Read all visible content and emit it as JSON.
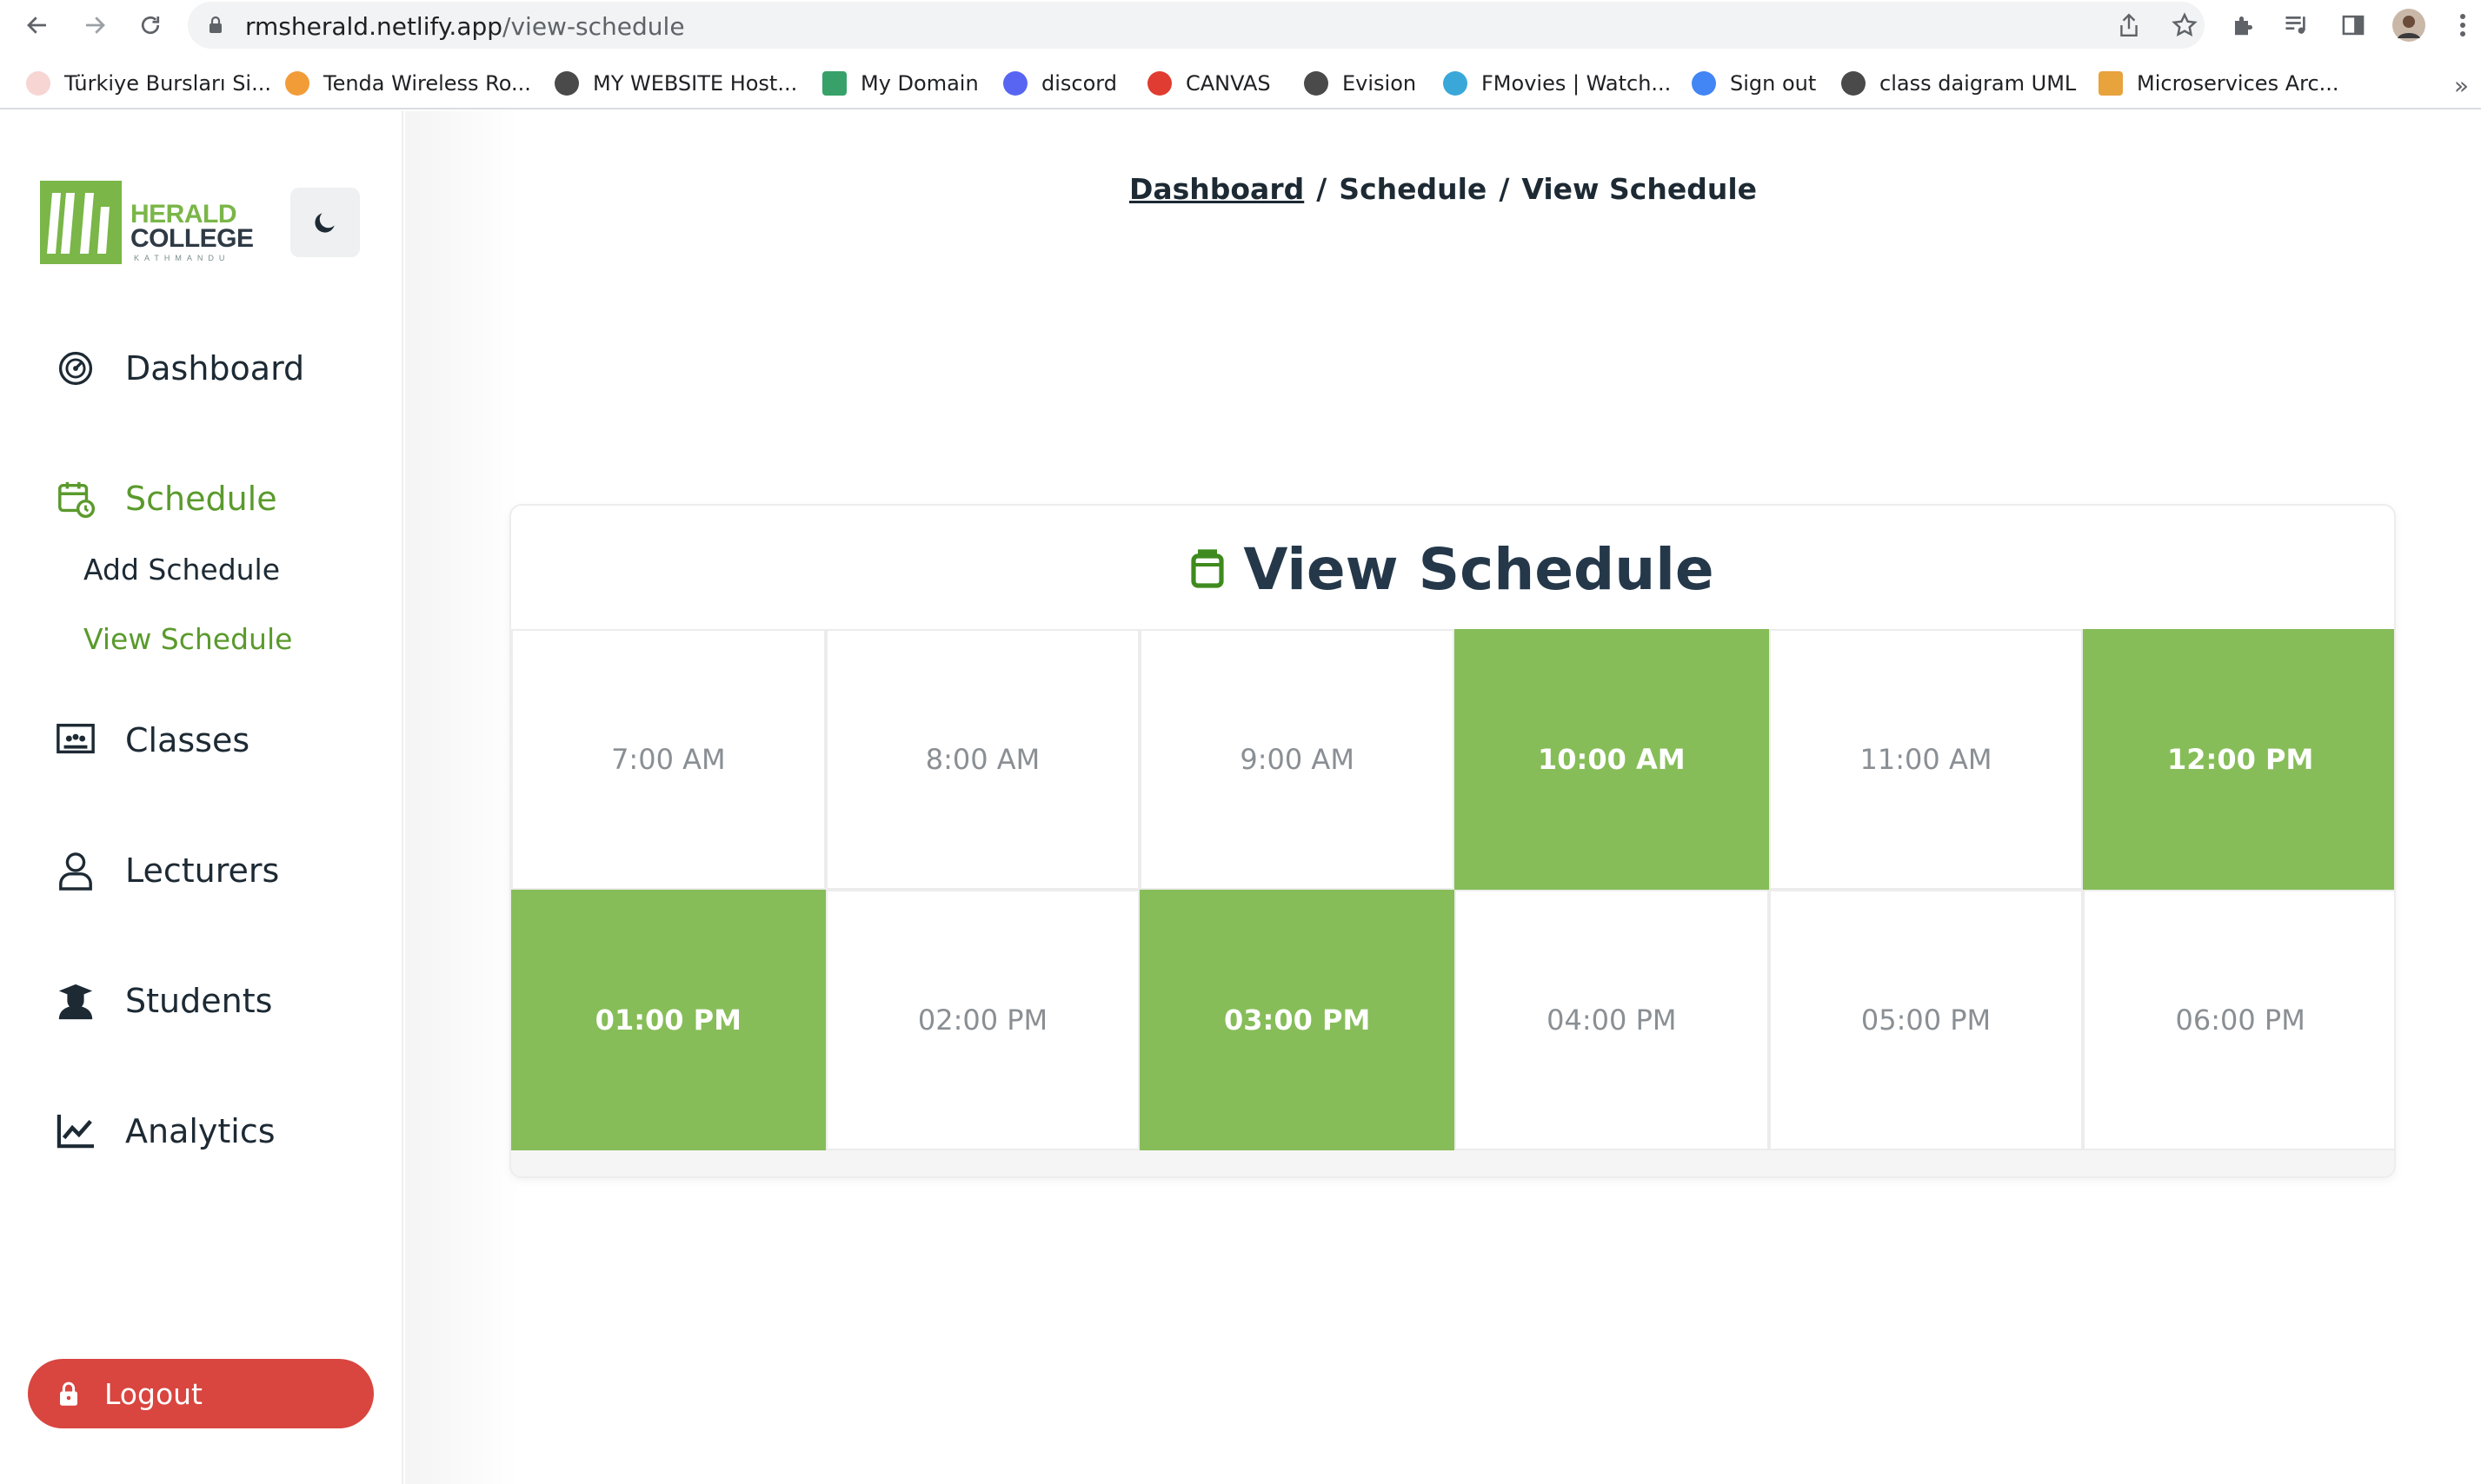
{
  "browser": {
    "url_host": "rmsherald.netlify.app",
    "url_path": "/view-schedule",
    "bookmarks": [
      {
        "label": "Türkiye Bursları Si...",
        "color": "#d93025"
      },
      {
        "label": "Tenda Wireless Ro...",
        "color": "#f29c38"
      },
      {
        "label": "MY WEBSITE Host...",
        "color": "#4a4a4a"
      },
      {
        "label": "My Domain",
        "color": "#38a169"
      },
      {
        "label": "discord",
        "color": "#5865f2"
      },
      {
        "label": "CANVAS",
        "color": "#e03c31"
      },
      {
        "label": "Evision",
        "color": "#4a4a4a"
      },
      {
        "label": "FMovies | Watch...",
        "color": "#3aa7d9"
      },
      {
        "label": "Sign out",
        "color": "#4285f4"
      },
      {
        "label": "class daigram UML",
        "color": "#4a4a4a"
      },
      {
        "label": "Microservices Arc...",
        "color": "#e8a33d"
      }
    ],
    "more": "»"
  },
  "logo": {
    "line1": "HERALD",
    "line2": "COLLEGE",
    "line3": "KATHMANDU"
  },
  "sidebar": {
    "dashboard": "Dashboard",
    "schedule": "Schedule",
    "add_schedule": "Add Schedule",
    "view_schedule": "View Schedule",
    "classes": "Classes",
    "lecturers": "Lecturers",
    "students": "Students",
    "analytics": "Analytics",
    "logout": "Logout"
  },
  "breadcrumb": {
    "item1": "Dashboard",
    "item2": "Schedule",
    "item3": "View Schedule",
    "separator": "/"
  },
  "card": {
    "title": "View Schedule"
  },
  "slots": [
    {
      "label": "7:00 AM",
      "selected": false
    },
    {
      "label": "8:00 AM",
      "selected": false
    },
    {
      "label": "9:00 AM",
      "selected": false
    },
    {
      "label": "10:00 AM",
      "selected": true
    },
    {
      "label": "11:00 AM",
      "selected": false
    },
    {
      "label": "12:00 PM",
      "selected": true
    },
    {
      "label": "01:00 PM",
      "selected": true
    },
    {
      "label": "02:00 PM",
      "selected": false
    },
    {
      "label": "03:00 PM",
      "selected": true
    },
    {
      "label": "04:00 PM",
      "selected": false
    },
    {
      "label": "05:00 PM",
      "selected": false
    },
    {
      "label": "06:00 PM",
      "selected": false
    }
  ],
  "colors": {
    "accent": "#5a9a2c",
    "selected_slot": "#86bd58",
    "logout": "#d9453f",
    "title": "#24384a"
  }
}
